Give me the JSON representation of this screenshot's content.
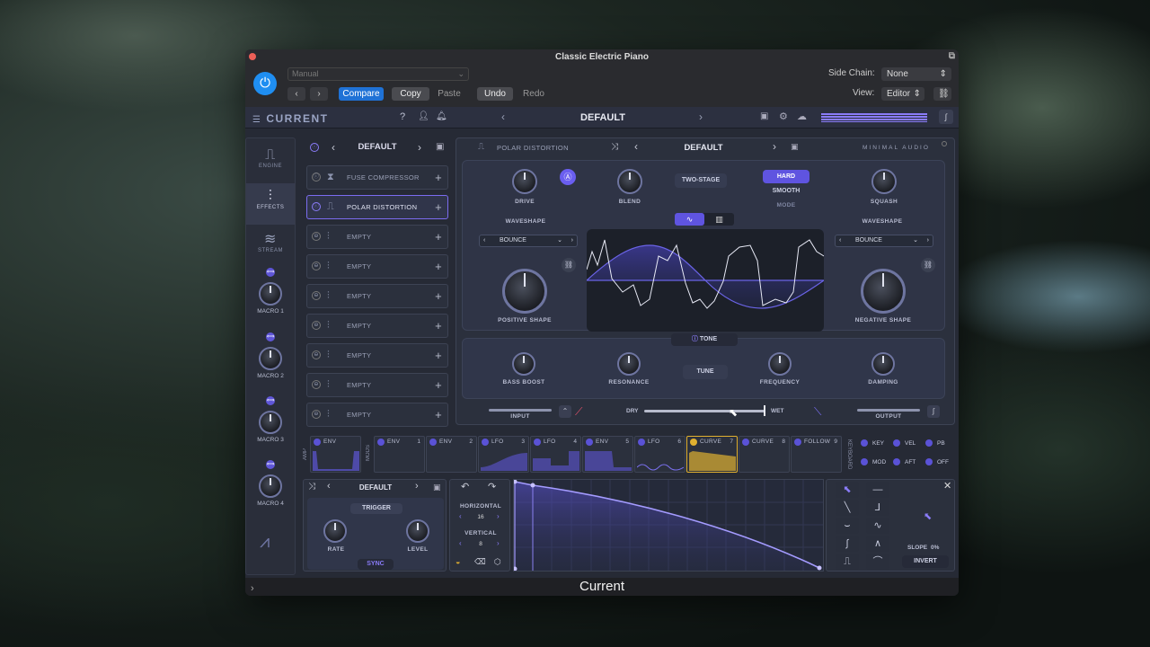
{
  "window": {
    "title": "Classic Electric Piano",
    "caption": "Current"
  },
  "host": {
    "preset_select": "Manual",
    "compare": "Compare",
    "copy": "Copy",
    "paste": "Paste",
    "undo": "Undo",
    "redo": "Redo",
    "sidechain_label": "Side Chain:",
    "sidechain_value": "None",
    "view_label": "View:",
    "view_value": "Editor"
  },
  "plugin": {
    "logo": "CURRENT",
    "preset": "DEFAULT"
  },
  "sidebar": {
    "engine": "ENGINE",
    "effects": "EFFECTS",
    "stream": "STREAM",
    "macros": [
      "MACRO 1",
      "MACRO 2",
      "MACRO 3",
      "MACRO 4"
    ]
  },
  "chain": {
    "preset": "DEFAULT",
    "slots": [
      "FUSE COMPRESSOR",
      "POLAR DISTORTION",
      "EMPTY",
      "EMPTY",
      "EMPTY",
      "EMPTY",
      "EMPTY",
      "EMPTY",
      "EMPTY"
    ]
  },
  "effect": {
    "name": "POLAR DISTORTION",
    "preset": "DEFAULT",
    "brand": "MINIMAL AUDIO",
    "drive": "DRIVE",
    "blend": "BLEND",
    "two_stage": "TWO-STAGE",
    "hard": "HARD",
    "smooth": "SMOOTH",
    "mode": "MODE",
    "squash": "SQUASH",
    "waveshape_left": "WAVESHAPE",
    "waveshape_right": "WAVESHAPE",
    "bounce_left": "BOUNCE",
    "bounce_right": "BOUNCE",
    "positive_shape": "POSITIVE SHAPE",
    "negative_shape": "NEGATIVE SHAPE",
    "tone": "TONE",
    "bass_boost": "BASS BOOST",
    "resonance": "RESONANCE",
    "tune": "TUNE",
    "frequency": "FREQUENCY",
    "damping": "DAMPING",
    "input": "INPUT",
    "dry": "DRY",
    "wet": "WET",
    "output": "OUTPUT"
  },
  "mods": {
    "amp": "AMP",
    "mods_label": "MODS",
    "keyboard": "KEYBOARD",
    "tabs": [
      {
        "name": "ENV",
        "num": ""
      },
      {
        "name": "ENV",
        "num": "1"
      },
      {
        "name": "ENV",
        "num": "2"
      },
      {
        "name": "LFO",
        "num": "3"
      },
      {
        "name": "LFO",
        "num": "4"
      },
      {
        "name": "ENV",
        "num": "5"
      },
      {
        "name": "LFO",
        "num": "6"
      },
      {
        "name": "CURVE",
        "num": "7"
      },
      {
        "name": "CURVE",
        "num": "8"
      },
      {
        "name": "FOLLOW",
        "num": "9"
      }
    ],
    "keys": [
      "KEY",
      "VEL",
      "PB",
      "MOD",
      "AFT",
      "OFF"
    ]
  },
  "lfo": {
    "preset": "DEFAULT",
    "trigger": "TRIGGER",
    "rate": "RATE",
    "level": "LEVEL",
    "sync": "SYNC",
    "horizontal": "HORIZONTAL",
    "horizontal_value": "16",
    "vertical": "VERTICAL",
    "vertical_value": "8",
    "slope_label": "SLOPE",
    "slope_value": "0%",
    "invert": "INVERT"
  }
}
